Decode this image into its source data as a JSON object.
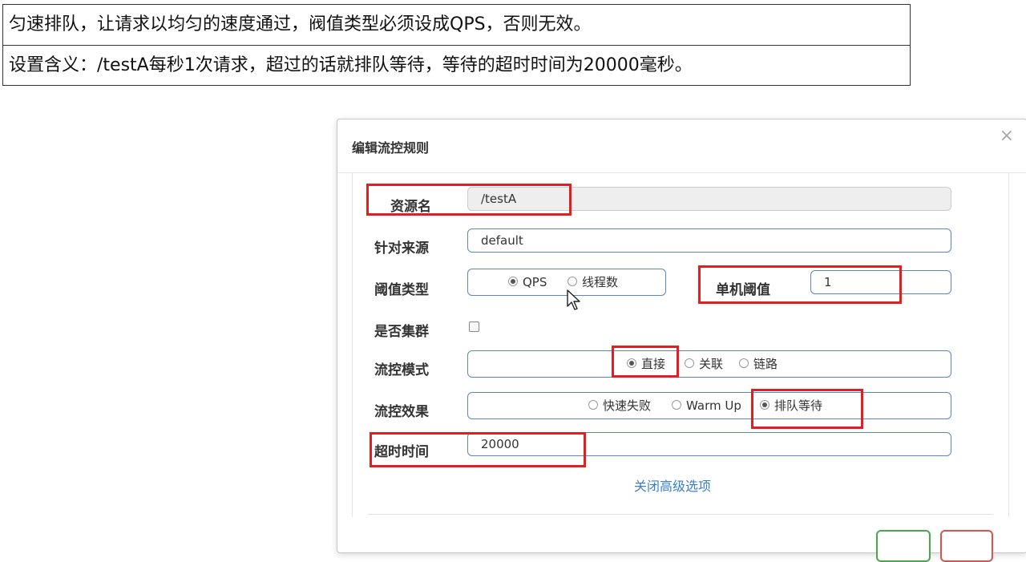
{
  "notes": {
    "line1": "匀速排队，让请求以均匀的速度通过，阀值类型必须设成QPS，否则无效。",
    "line2": "设置含义：/testA每秒1次请求，超过的话就排队等待，等待的超时时间为20000毫秒。"
  },
  "modal": {
    "title": "编辑流控规则",
    "close": "×",
    "resource": {
      "label": "资源名",
      "value": "/testA"
    },
    "source": {
      "label": "针对来源",
      "value": "default"
    },
    "threshold_type": {
      "label": "阈值类型",
      "options": [
        "QPS",
        "线程数"
      ],
      "selected": "QPS"
    },
    "single_threshold": {
      "label": "单机阈值",
      "value": "1"
    },
    "cluster": {
      "label": "是否集群",
      "checked": false
    },
    "flow_mode": {
      "label": "流控模式",
      "options": [
        "直接",
        "关联",
        "链路"
      ],
      "selected": "直接"
    },
    "flow_effect": {
      "label": "流控效果",
      "options": [
        "快速失败",
        "Warm Up",
        "排队等待"
      ],
      "selected": "排队等待"
    },
    "timeout": {
      "label": "超时时间",
      "value": "20000"
    },
    "advanced_link": "关闭高级选项"
  },
  "colors": {
    "highlight": "#e02020",
    "accent_border": "#5a87c5",
    "link": "#3a7fc4",
    "save": "#49a849",
    "cancel": "#d9534f"
  }
}
